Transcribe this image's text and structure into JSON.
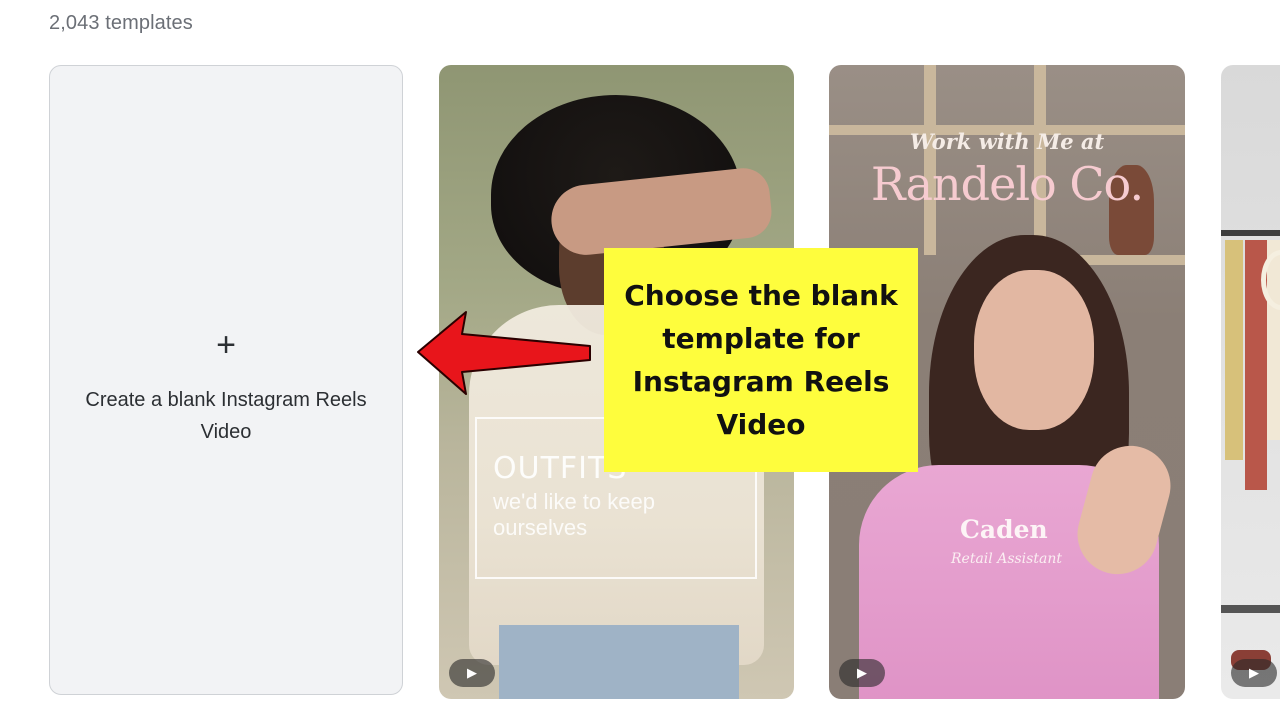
{
  "results": {
    "count_label": "2,043 templates"
  },
  "blank_card": {
    "plus_glyph": "+",
    "label": "Create a blank Instagram Reels Video"
  },
  "templates": [
    {
      "title": "OUTFITS",
      "subtitle": "we'd like to keep ourselves",
      "play_icon": "play-icon"
    },
    {
      "kicker": "Work with Me at",
      "brand": "Randelo Co.",
      "name": "Caden",
      "role": "Retail Assistant",
      "play_icon": "play-icon"
    },
    {
      "play_icon": "play-icon"
    }
  ],
  "annotation": {
    "callout_text": "Choose the blank template for Instagram Reels Video",
    "callout_color": "#fefd3d",
    "arrow_color": "#e8151b"
  }
}
